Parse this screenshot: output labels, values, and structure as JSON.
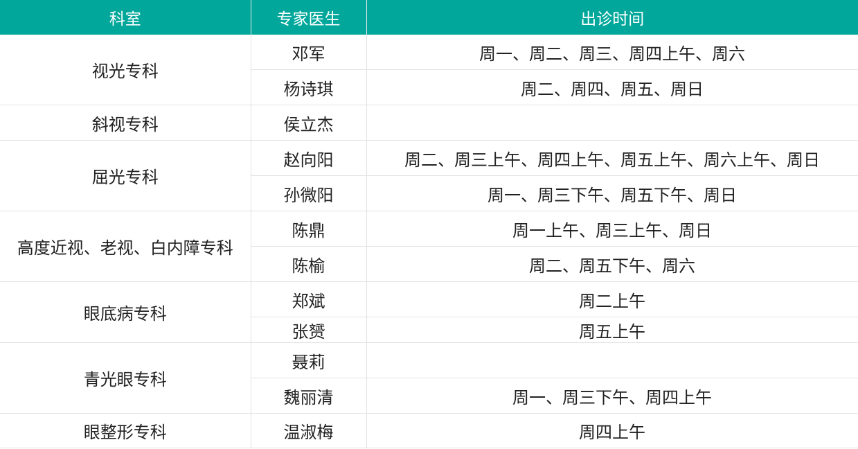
{
  "header": {
    "department": "科室",
    "doctor": "专家医生",
    "schedule": "出诊时间"
  },
  "rows": [
    {
      "department": "视光专科",
      "doctor": "邓军",
      "schedule": "周一、周二、周三、周四上午、周六"
    },
    {
      "department": "",
      "doctor": "杨诗琪",
      "schedule": "周二、周四、周五、周日"
    },
    {
      "department": "斜视专科",
      "doctor": "侯立杰",
      "schedule": ""
    },
    {
      "department": "屈光专科",
      "doctor": "赵向阳",
      "schedule": "周二、周三上午、周四上午、周五上午、周六上午、周日"
    },
    {
      "department": "",
      "doctor": "孙微阳",
      "schedule": "周一、周三下午、周五下午、周日"
    },
    {
      "department": "高度近视、老视、白内障专科",
      "doctor": "陈鼎",
      "schedule": "周一上午、周三上午、周日"
    },
    {
      "department": "",
      "doctor": "陈榆",
      "schedule": "周二、周五下午、周六"
    },
    {
      "department": "眼底病专科",
      "doctor": "郑斌",
      "schedule": "周二上午"
    },
    {
      "department": "",
      "doctor": "张赟",
      "schedule": "周五上午"
    },
    {
      "department": "青光眼专科",
      "doctor": "聂莉",
      "schedule": ""
    },
    {
      "department": "",
      "doctor": "魏丽清",
      "schedule": "周一、周三下午、周四上午"
    },
    {
      "department": "眼整形专科",
      "doctor": "温淑梅",
      "schedule": "周四上午"
    }
  ]
}
